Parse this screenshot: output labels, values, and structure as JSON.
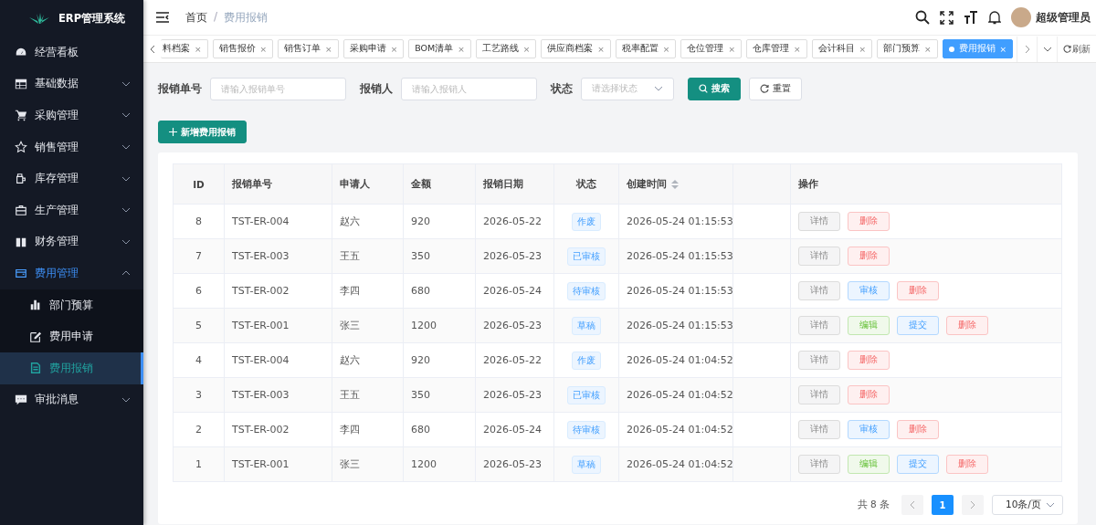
{
  "sidebar": {
    "title": "ERP管理系统",
    "items": [
      {
        "label": "经营看板",
        "kind": "link",
        "expanded": false
      },
      {
        "label": "基础数据",
        "kind": "group",
        "expanded": false
      },
      {
        "label": "采购管理",
        "kind": "group",
        "expanded": false
      },
      {
        "label": "销售管理",
        "kind": "group",
        "expanded": false
      },
      {
        "label": "库存管理",
        "kind": "group",
        "expanded": false
      },
      {
        "label": "生产管理",
        "kind": "group",
        "expanded": false
      },
      {
        "label": "财务管理",
        "kind": "group",
        "expanded": false
      },
      {
        "label": "费用管理",
        "kind": "group",
        "expanded": true,
        "children": [
          {
            "label": "部门预算",
            "selected": false
          },
          {
            "label": "费用申请",
            "selected": false
          },
          {
            "label": "费用报销",
            "selected": true
          }
        ]
      },
      {
        "label": "审批消息",
        "kind": "group",
        "expanded": false
      }
    ]
  },
  "header": {
    "breadcrumb": [
      "首页",
      "费用报销"
    ],
    "breadcrumb_separator": "/",
    "user": "超级管理员"
  },
  "tabs": [
    {
      "label": "料档案",
      "selected": false
    },
    {
      "label": "销售报价",
      "selected": false
    },
    {
      "label": "销售订单",
      "selected": false
    },
    {
      "label": "采购申请",
      "selected": false
    },
    {
      "label": "BOM清单",
      "selected": false
    },
    {
      "label": "工艺路线",
      "selected": false
    },
    {
      "label": "供应商档案",
      "selected": false
    },
    {
      "label": "税率配置",
      "selected": false
    },
    {
      "label": "仓位管理",
      "selected": false
    },
    {
      "label": "仓库管理",
      "selected": false
    },
    {
      "label": "会计科目",
      "selected": false
    },
    {
      "label": "部门预算",
      "selected": false
    },
    {
      "label": "费用报销",
      "selected": true
    }
  ],
  "tab_close": "×",
  "refresh": "刷新",
  "filters": [
    {
      "label": "报销单号",
      "kind": "input",
      "placeholder": "请输入报销单号"
    },
    {
      "label": "报销人",
      "kind": "input",
      "placeholder": "请输入报销人"
    },
    {
      "label": "状态",
      "kind": "select",
      "placeholder": "请选择状态"
    }
  ],
  "search_button": "搜索",
  "reset_button": "重置",
  "add_button": "新增费用报销",
  "table": {
    "columns": [
      {
        "label": "ID",
        "kind": "plain"
      },
      {
        "label": "报销单号",
        "kind": "plain"
      },
      {
        "label": "申请人",
        "kind": "plain"
      },
      {
        "label": "金额",
        "kind": "plain"
      },
      {
        "label": "报销日期",
        "kind": "plain"
      },
      {
        "label": "状态",
        "kind": "plain"
      },
      {
        "label": "创建时间",
        "kind": "sortable"
      },
      {
        "label": "操作",
        "kind": "plain"
      }
    ],
    "rows": [
      {
        "id": "8",
        "no": "TST-ER-004",
        "applicant": "赵六",
        "amount": "920",
        "date": "2026-05-22",
        "status": "作废",
        "created": "2026-05-24 01:15:53",
        "actions": [
          {
            "label": "详情",
            "kind": "detail"
          },
          {
            "label": "删除",
            "kind": "delete"
          }
        ]
      },
      {
        "id": "7",
        "no": "TST-ER-003",
        "applicant": "王五",
        "amount": "350",
        "date": "2026-05-23",
        "status": "已审核",
        "created": "2026-05-24 01:15:53",
        "actions": [
          {
            "label": "详情",
            "kind": "detail"
          },
          {
            "label": "删除",
            "kind": "delete"
          }
        ]
      },
      {
        "id": "6",
        "no": "TST-ER-002",
        "applicant": "李四",
        "amount": "680",
        "date": "2026-05-24",
        "status": "待审核",
        "created": "2026-05-24 01:15:53",
        "actions": [
          {
            "label": "详情",
            "kind": "detail"
          },
          {
            "label": "审核",
            "kind": "audit"
          },
          {
            "label": "删除",
            "kind": "delete"
          }
        ]
      },
      {
        "id": "5",
        "no": "TST-ER-001",
        "applicant": "张三",
        "amount": "1200",
        "date": "2026-05-23",
        "status": "草稿",
        "created": "2026-05-24 01:15:53",
        "actions": [
          {
            "label": "详情",
            "kind": "detail"
          },
          {
            "label": "编辑",
            "kind": "edit"
          },
          {
            "label": "提交",
            "kind": "submit"
          },
          {
            "label": "删除",
            "kind": "delete"
          }
        ]
      },
      {
        "id": "4",
        "no": "TST-ER-004",
        "applicant": "赵六",
        "amount": "920",
        "date": "2026-05-22",
        "status": "作废",
        "created": "2026-05-24 01:04:52",
        "actions": [
          {
            "label": "详情",
            "kind": "detail"
          },
          {
            "label": "删除",
            "kind": "delete"
          }
        ]
      },
      {
        "id": "3",
        "no": "TST-ER-003",
        "applicant": "王五",
        "amount": "350",
        "date": "2026-05-23",
        "status": "已审核",
        "created": "2026-05-24 01:04:52",
        "actions": [
          {
            "label": "详情",
            "kind": "detail"
          },
          {
            "label": "删除",
            "kind": "delete"
          }
        ]
      },
      {
        "id": "2",
        "no": "TST-ER-002",
        "applicant": "李四",
        "amount": "680",
        "date": "2026-05-24",
        "status": "待审核",
        "created": "2026-05-24 01:04:52",
        "actions": [
          {
            "label": "详情",
            "kind": "detail"
          },
          {
            "label": "审核",
            "kind": "audit"
          },
          {
            "label": "删除",
            "kind": "delete"
          }
        ]
      },
      {
        "id": "1",
        "no": "TST-ER-001",
        "applicant": "张三",
        "amount": "1200",
        "date": "2026-05-23",
        "status": "草稿",
        "created": "2026-05-24 01:04:52",
        "actions": [
          {
            "label": "详情",
            "kind": "detail"
          },
          {
            "label": "编辑",
            "kind": "edit"
          },
          {
            "label": "提交",
            "kind": "submit"
          },
          {
            "label": "删除",
            "kind": "delete"
          }
        ]
      }
    ]
  },
  "pagination": {
    "total": "共 8 条",
    "pages": [
      {
        "label": "1",
        "selected": true
      }
    ],
    "page_size": "10条/页"
  }
}
